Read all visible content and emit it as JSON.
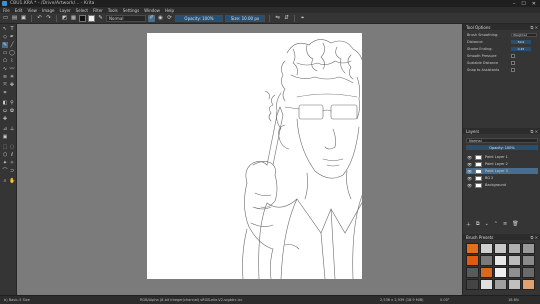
{
  "window": {
    "title": "CBU1.KRA * - /Drive/Artwork/... - Krita",
    "controls": [
      "–",
      "☐",
      "✕"
    ]
  },
  "menu": [
    "File",
    "Edit",
    "View",
    "Image",
    "Layer",
    "Select",
    "Filter",
    "Tools",
    "Settings",
    "Window",
    "Help"
  ],
  "toolbar": {
    "blend_mode": "Normal",
    "opacity": "Opacity: 100%",
    "size": "Size: 10.00 px",
    "fg_color": "#111111",
    "bg_color": "#f0f0f0"
  },
  "tool_options": {
    "title": "Tool Options",
    "rows": [
      {
        "label": "Brush Smoothing:",
        "value": "Weighted"
      },
      {
        "label": "Distance:",
        "value": "50.0"
      },
      {
        "label": "Stroke Ending:",
        "value": "0.15"
      },
      {
        "label": "Smooth Pressure",
        "value": ""
      },
      {
        "label": "Scalable Distance",
        "value": ""
      },
      {
        "label": "Snap to Assistants",
        "value": ""
      }
    ]
  },
  "layers": {
    "title": "Layers",
    "blend_mode": "Normal",
    "opacity": "Opacity: 100%",
    "items": [
      {
        "name": "Paint Layer 1"
      },
      {
        "name": "Paint Layer 2"
      },
      {
        "name": "Paint Layer 3"
      },
      {
        "name": "BG 2"
      },
      {
        "name": "Background"
      }
    ],
    "selected_index": 2
  },
  "brush_presets": {
    "title": "Brush Presets",
    "swatches": [
      "#e07020",
      "#d0d0d0",
      "#c8c8c8",
      "#b0b0b0",
      "#9a9a9a",
      "#e05a10",
      "#7a7a7a",
      "#e8e8e8",
      "#bcbcbc",
      "#8a8a8a",
      "#5a5a5a",
      "#d86a20",
      "#f0f0f0",
      "#909090",
      "#6a6a6a",
      "#444444",
      "#e0e0e0",
      "#a0a0a0",
      "#c0c0c0",
      "#e0a070"
    ]
  },
  "status": {
    "brush": "b) Basic-5 Size",
    "info": "RGB/Alpha (8-bit integer/channel) sRGB-elle-V2-srgbtrc.icc",
    "size": "2,536 x 2,939 (18.9 MiB)",
    "angle": "0.00°",
    "zoom": "18.8%"
  }
}
